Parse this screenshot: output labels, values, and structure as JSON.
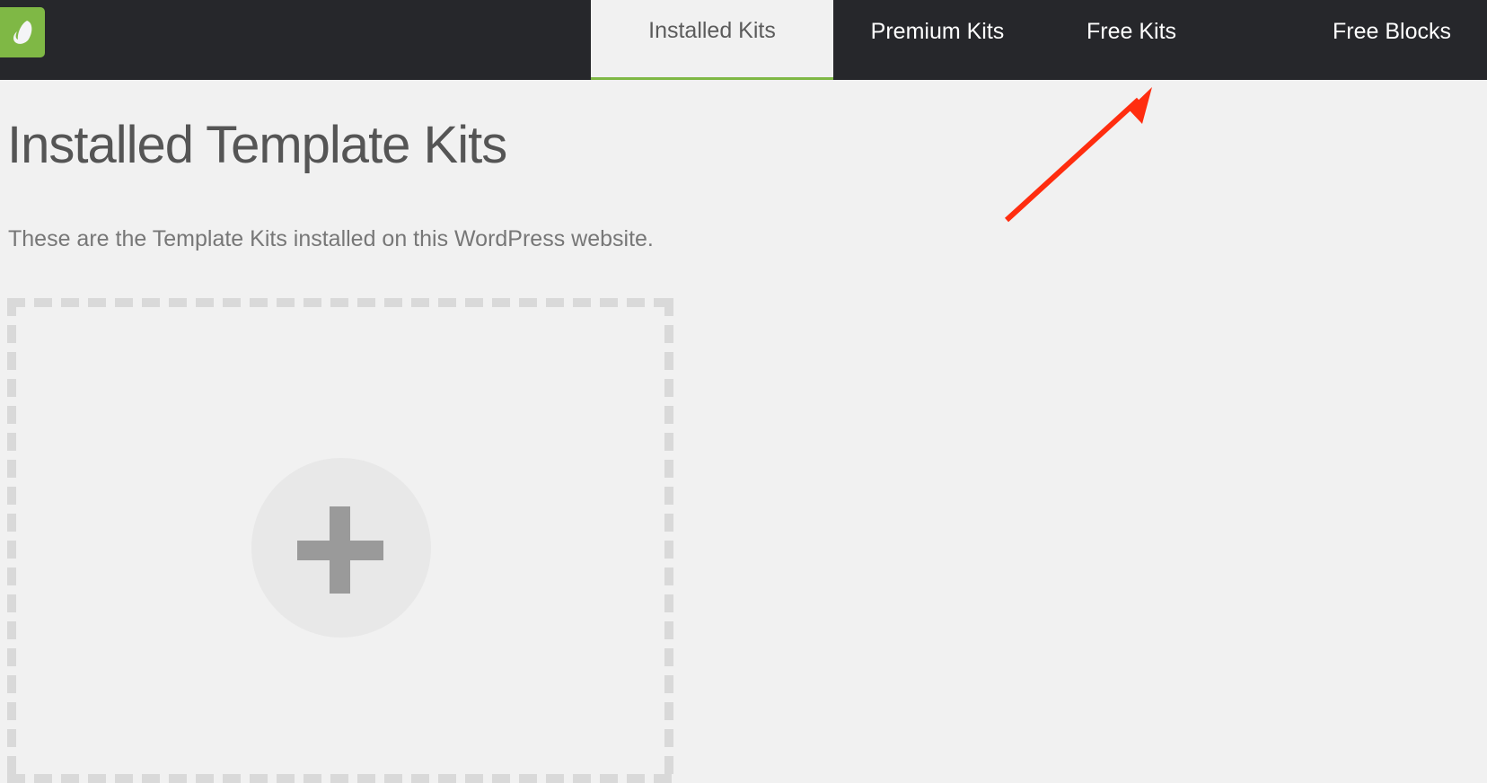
{
  "header": {
    "logo_icon": "envato-leaf-icon",
    "tabs": [
      {
        "label": "Installed Kits",
        "active": true
      },
      {
        "label": "Premium Kits",
        "active": false
      },
      {
        "label": "Free Kits",
        "active": false
      },
      {
        "label": "Free Blocks",
        "active": false
      }
    ]
  },
  "main": {
    "title": "Installed Template Kits",
    "description": "These are the Template Kits installed on this WordPress website.",
    "add_kit_icon": "plus-icon"
  },
  "annotation": {
    "type": "arrow",
    "points_to": "Free Kits",
    "color": "#ff2d0f"
  },
  "colors": {
    "nav_bg": "#26272b",
    "accent": "#7fb845",
    "page_bg": "#f1f1f1"
  }
}
